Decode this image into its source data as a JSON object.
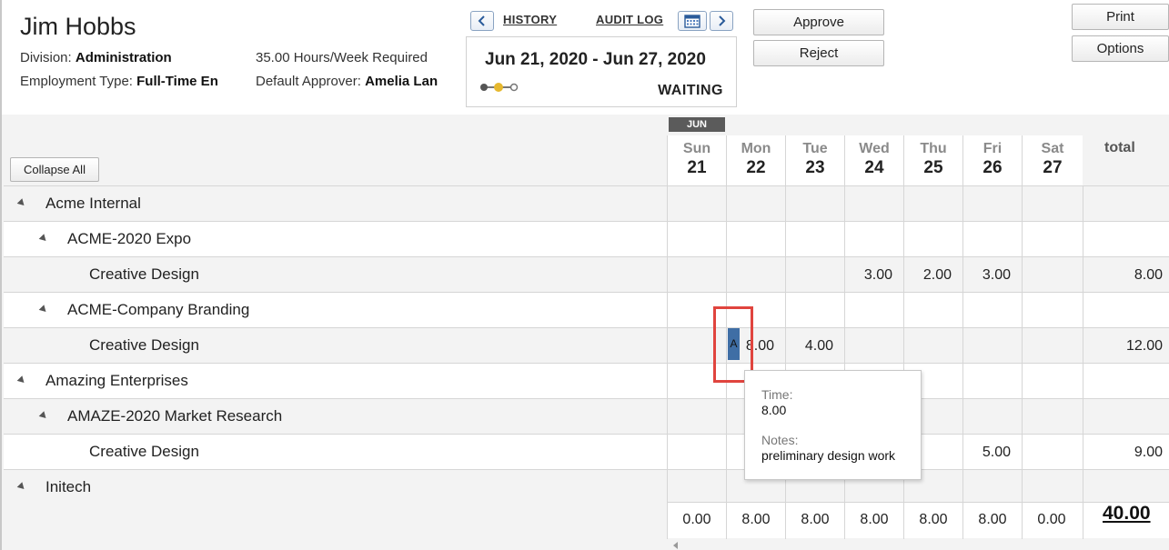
{
  "employee": {
    "name": "Jim Hobbs",
    "division_label": "Division:",
    "division": "Administration",
    "employment_type_label": "Employment Type:",
    "employment_type": "Full-Time En",
    "hours_required": "35.00 Hours/Week Required",
    "approver_label": "Default Approver:",
    "approver": "Amelia Lan"
  },
  "nav": {
    "history": "HISTORY",
    "audit_log": "AUDIT LOG"
  },
  "period": {
    "range": "Jun 21, 2020 - Jun 27, 2020",
    "status": "WAITING"
  },
  "buttons": {
    "approve": "Approve",
    "reject": "Reject",
    "print": "Print",
    "options": "Options",
    "collapse_all": "Collapse All"
  },
  "grid": {
    "month": "JUN",
    "days": [
      {
        "name": "Sun",
        "num": "21"
      },
      {
        "name": "Mon",
        "num": "22"
      },
      {
        "name": "Tue",
        "num": "23"
      },
      {
        "name": "Wed",
        "num": "24"
      },
      {
        "name": "Thu",
        "num": "25"
      },
      {
        "name": "Fri",
        "num": "26"
      },
      {
        "name": "Sat",
        "num": "27"
      }
    ],
    "total_label": "total",
    "rows": [
      {
        "label": "Acme Internal",
        "level": 0,
        "cells": [
          "",
          "",
          "",
          "",
          "",
          "",
          ""
        ],
        "total": ""
      },
      {
        "label": "ACME-2020 Expo",
        "level": 1,
        "cells": [
          "",
          "",
          "",
          "",
          "",
          "",
          ""
        ],
        "total": ""
      },
      {
        "label": "Creative Design",
        "level": 2,
        "cells": [
          "",
          "",
          "",
          "3.00",
          "2.00",
          "3.00",
          ""
        ],
        "total": "8.00"
      },
      {
        "label": "ACME-Company Branding",
        "level": 1,
        "cells": [
          "",
          "",
          "",
          "",
          "",
          "",
          ""
        ],
        "total": ""
      },
      {
        "label": "Creative Design",
        "level": 2,
        "cells": [
          "",
          "8.00",
          "4.00",
          "",
          "",
          "",
          ""
        ],
        "total": "12.00"
      },
      {
        "label": "Amazing Enterprises",
        "level": 0,
        "cells": [
          "",
          "",
          "",
          "",
          "",
          "",
          ""
        ],
        "total": ""
      },
      {
        "label": "AMAZE-2020 Market Research",
        "level": 1,
        "cells": [
          "",
          "",
          "",
          "",
          "",
          "",
          ""
        ],
        "total": ""
      },
      {
        "label": "Creative Design",
        "level": 2,
        "cells": [
          "",
          "",
          "",
          "",
          "",
          "5.00",
          ""
        ],
        "total": "9.00"
      },
      {
        "label": "Initech",
        "level": 0,
        "cells": [
          "",
          "",
          "",
          "",
          "",
          "",
          ""
        ],
        "total": ""
      }
    ],
    "day_totals": [
      "0.00",
      "8.00",
      "8.00",
      "8.00",
      "8.00",
      "8.00",
      "0.00"
    ],
    "grand_total": "40.00"
  },
  "cell_marker": "A",
  "tooltip": {
    "time_label": "Time:",
    "time_value": "8.00",
    "notes_label": "Notes:",
    "notes_value": "preliminary design work"
  }
}
